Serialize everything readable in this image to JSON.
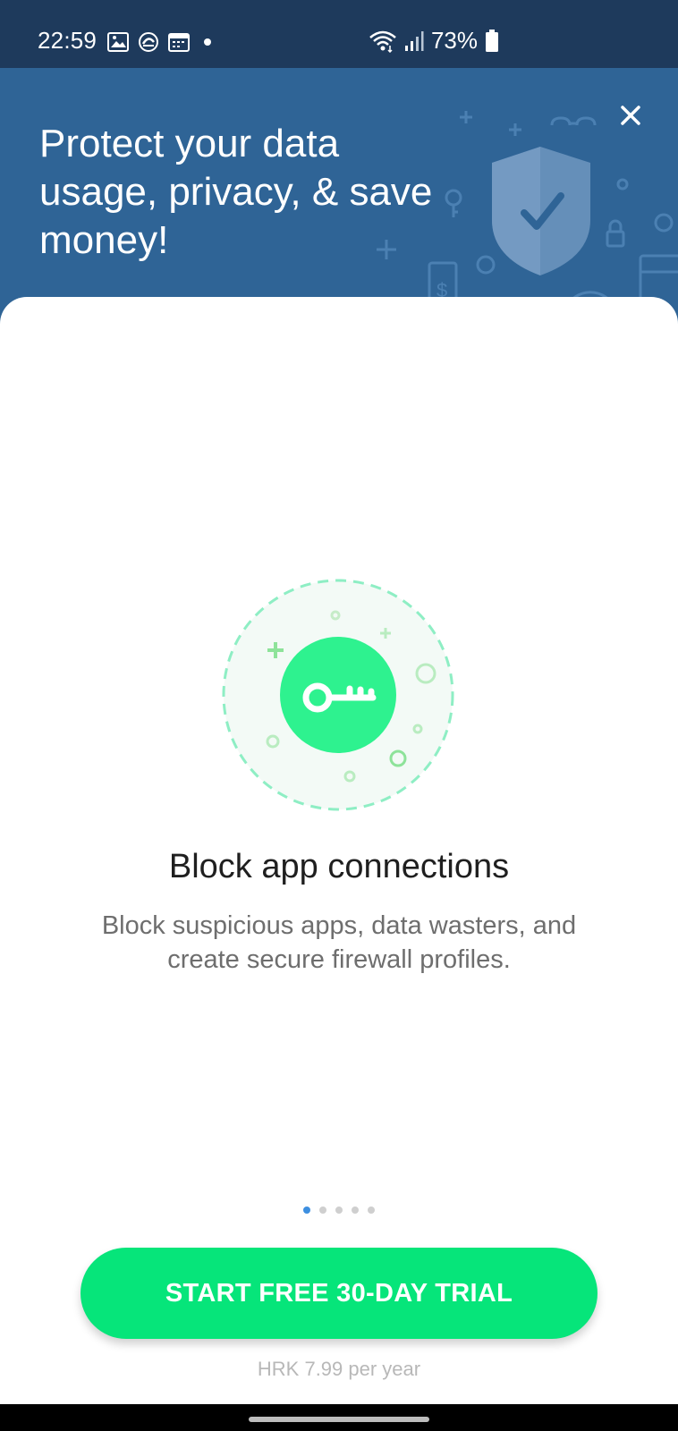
{
  "status_bar": {
    "time": "22:59",
    "battery": "73%",
    "icons": [
      "image-icon",
      "sync-icon",
      "calendar-icon",
      "dot-icon",
      "wifi-icon",
      "signal-icon",
      "battery-icon"
    ]
  },
  "header": {
    "title": "Protect your data usage, privacy, & save money!",
    "close_icon": "close-icon"
  },
  "feature": {
    "icon": "key-icon",
    "title": "Block app connections",
    "description": "Block suspicious apps, data wasters, and create secure firewall profiles."
  },
  "pager": {
    "total": 5,
    "active_index": 0
  },
  "cta": {
    "label": "START FREE 30-DAY TRIAL",
    "price": "HRK 7.99 per year"
  },
  "colors": {
    "status_bar": "#1e3a5c",
    "header_bg": "#2f6496",
    "accent_green": "#06e57a",
    "active_dot": "#3d8fe0"
  }
}
